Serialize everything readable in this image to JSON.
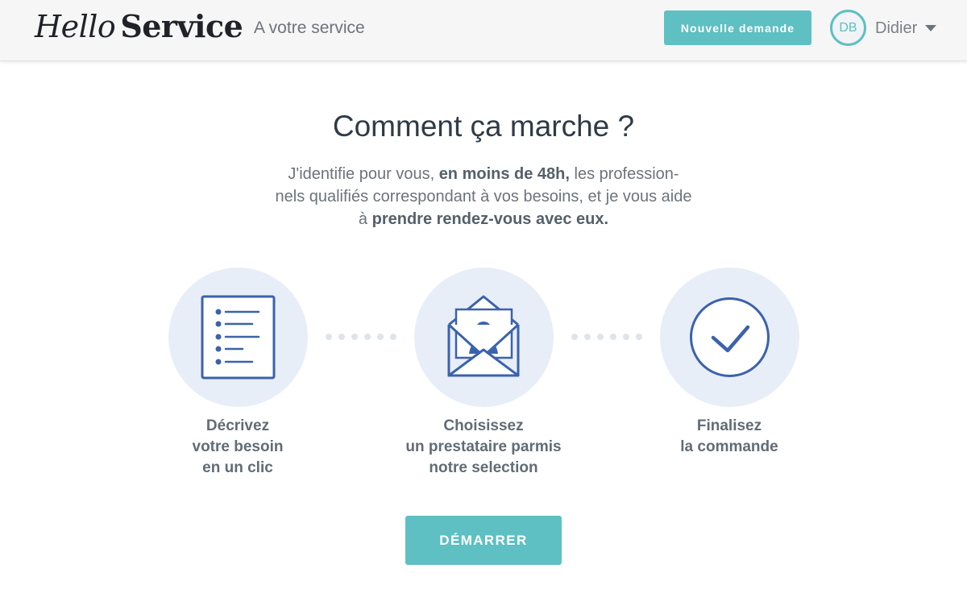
{
  "header": {
    "logo_part1": "Hello",
    "logo_part2": "Service",
    "tagline": "A votre service",
    "new_request_label": "Nouvelle demande",
    "avatar_initials": "DB",
    "user_name": "Didier"
  },
  "main": {
    "title": "Comment ça marche ?",
    "intro": {
      "t1": "J'identifie pour vous, ",
      "b1": "en moins de 48h,",
      "t2": " les profession-nels qualifiés correspondant à vos besoins, et je vous aide à ",
      "b2": "prendre rendez-vous avec eux."
    },
    "steps": [
      {
        "icon": "checklist-icon",
        "lines": [
          "Décrivez",
          "votre besoin",
          "en un clic"
        ]
      },
      {
        "icon": "envelope-profile-icon",
        "lines": [
          "Choisissez",
          "un prestataire parmis",
          "notre selection"
        ]
      },
      {
        "icon": "checkmark-circle-icon",
        "lines": [
          "Finalisez",
          "la commande"
        ]
      }
    ],
    "start_label": "DÉMARRER"
  },
  "colors": {
    "accent": "#5ec0c2",
    "icon_blue": "#3b62ad",
    "circle_bg": "#e8eef8"
  }
}
